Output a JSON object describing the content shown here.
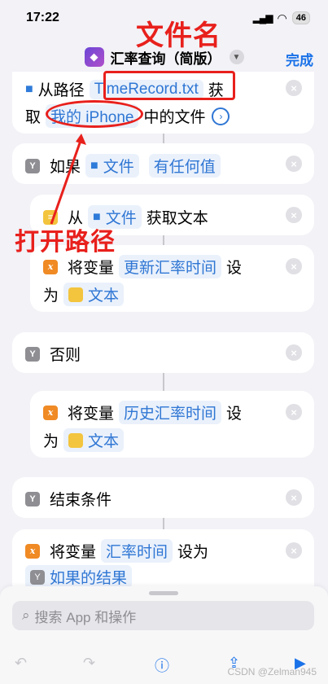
{
  "status": {
    "time": "17:22",
    "battery": "46"
  },
  "nav": {
    "title": "汇率查询（简版）",
    "done": "完成"
  },
  "annotations": {
    "filename": "文件名",
    "open_path": "打开路径"
  },
  "actions": {
    "get_file": {
      "prefix": "从路径",
      "path": "TimeRecord.txt",
      "suffix": "获",
      "line2_prefix": "取",
      "location": "我的 iPhone",
      "line2_suffix": "中的文件"
    },
    "if": {
      "label": "如果",
      "file": "文件",
      "condition": "有任何值"
    },
    "get_text": {
      "prefix": "从",
      "file": "文件",
      "suffix": "获取文本"
    },
    "set_var1": {
      "prefix": "将变量",
      "var": "更新汇率时间",
      "suffix": "设",
      "line2_prefix": "为",
      "value": "文本"
    },
    "otherwise": {
      "label": "否则"
    },
    "set_var2": {
      "prefix": "将变量",
      "var": "历史汇率时间",
      "suffix": "设",
      "line2_prefix": "为",
      "value": "文本"
    },
    "end_if": {
      "label": "结束条件"
    },
    "set_var3": {
      "prefix": "将变量",
      "var": "汇率时间",
      "suffix": "设为",
      "value": "如果的结果"
    }
  },
  "search": {
    "placeholder": "搜索 App 和操作"
  },
  "watermark": "CSDN @Zelman945"
}
